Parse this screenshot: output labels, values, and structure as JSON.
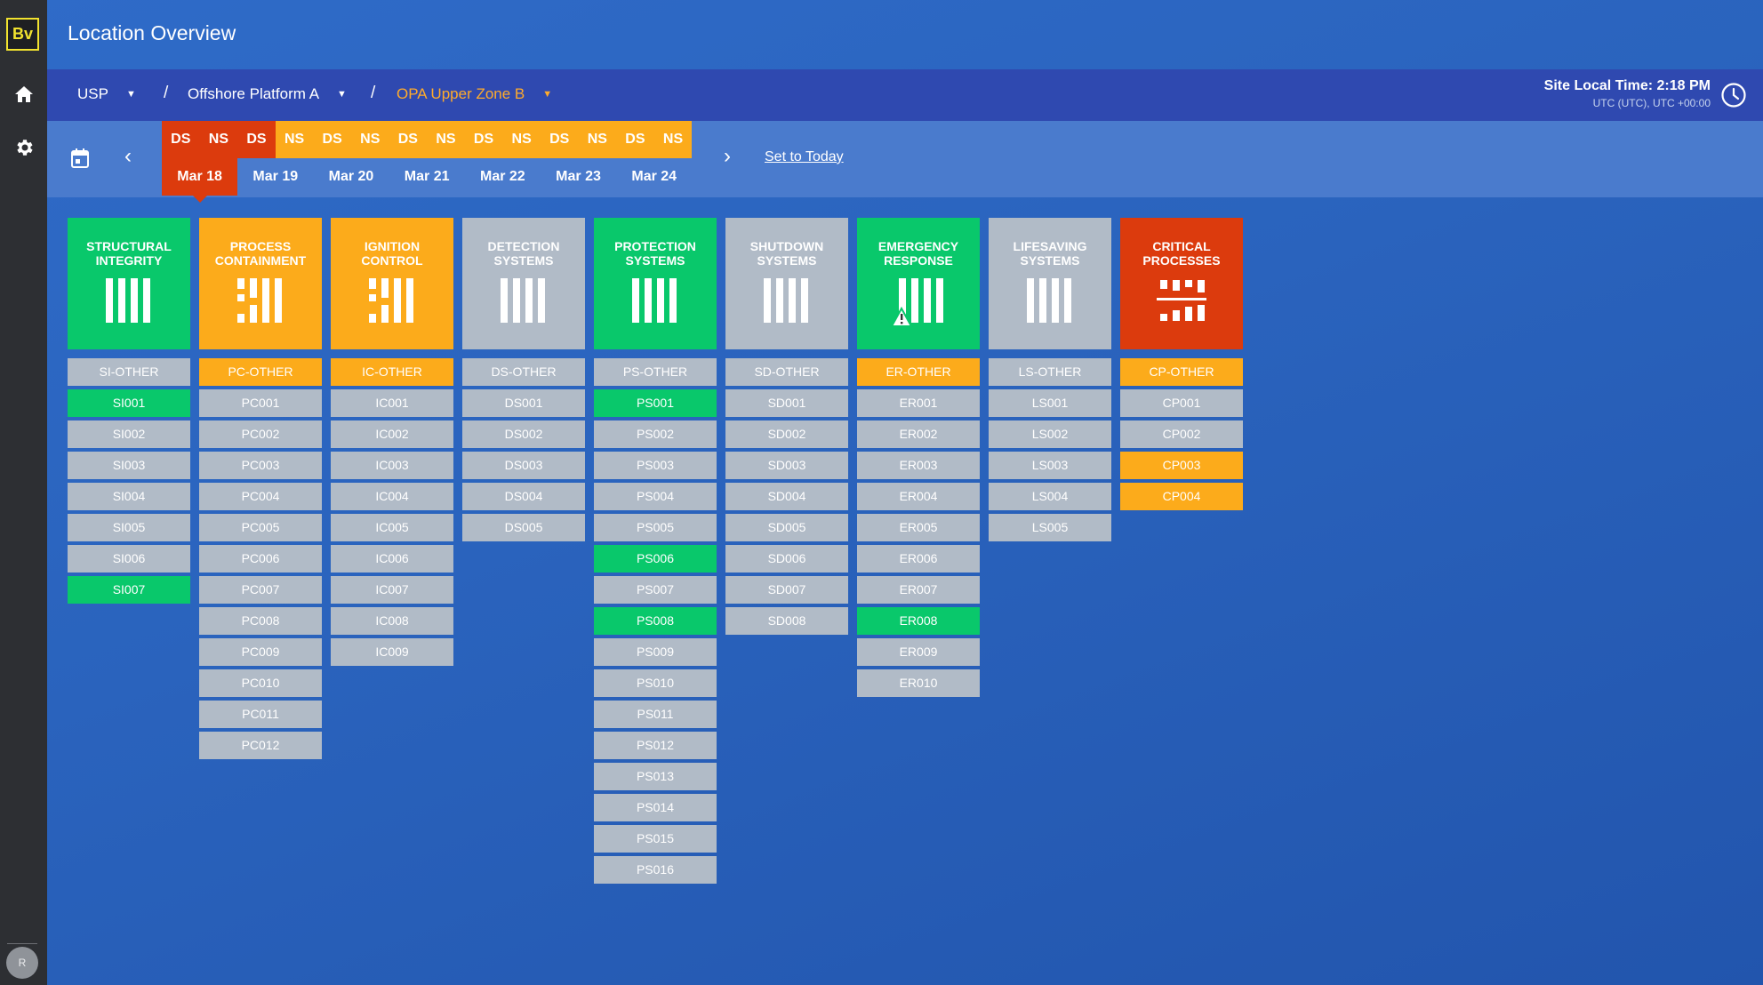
{
  "app": {
    "logo": "Bv",
    "title": "Location Overview"
  },
  "rail": {
    "home_icon": "home-icon",
    "settings_icon": "gear-icon",
    "avatar_initial": "R"
  },
  "breadcrumb": {
    "items": [
      {
        "label": "USP"
      },
      {
        "label": "Offshore Platform A"
      },
      {
        "label": "OPA Upper Zone B"
      }
    ],
    "separator": "/"
  },
  "site_time": {
    "label": "Site Local Time: 2:18 PM",
    "timezone": "UTC (UTC), UTC +00:00"
  },
  "date_nav": {
    "shifts": [
      "DS",
      "NS",
      "DS",
      "NS",
      "DS",
      "NS",
      "DS",
      "NS",
      "DS",
      "NS",
      "DS",
      "NS",
      "DS",
      "NS"
    ],
    "days": [
      "Mar 18",
      "Mar 19",
      "Mar 20",
      "Mar 21",
      "Mar 22",
      "Mar 23",
      "Mar 24"
    ],
    "set_today": "Set to Today",
    "prev": "‹",
    "next": "›"
  },
  "colors": {
    "green": "#09c86b",
    "amber": "#fcab1b",
    "red": "#dc3b0d",
    "grey": "#b1bbc7",
    "header": "#2f49b0"
  },
  "columns": [
    {
      "title": [
        "STRUCTURAL",
        "INTEGRITY"
      ],
      "status": "green",
      "glyph": "bars",
      "items": [
        [
          "SI-OTHER",
          "grey"
        ],
        [
          "SI001",
          "green"
        ],
        [
          "SI002",
          "grey"
        ],
        [
          "SI003",
          "grey"
        ],
        [
          "SI004",
          "grey"
        ],
        [
          "SI005",
          "grey"
        ],
        [
          "SI006",
          "grey"
        ],
        [
          "SI007",
          "green"
        ]
      ]
    },
    {
      "title": [
        "PROCESS",
        "CONTAINMENT"
      ],
      "status": "amber",
      "glyph": "broken",
      "items": [
        [
          "PC-OTHER",
          "amber"
        ],
        [
          "PC001",
          "grey"
        ],
        [
          "PC002",
          "grey"
        ],
        [
          "PC003",
          "grey"
        ],
        [
          "PC004",
          "grey"
        ],
        [
          "PC005",
          "grey"
        ],
        [
          "PC006",
          "grey"
        ],
        [
          "PC007",
          "grey"
        ],
        [
          "PC008",
          "grey"
        ],
        [
          "PC009",
          "grey"
        ],
        [
          "PC010",
          "grey"
        ],
        [
          "PC011",
          "grey"
        ],
        [
          "PC012",
          "grey"
        ]
      ]
    },
    {
      "title": [
        "IGNITION",
        "CONTROL"
      ],
      "status": "amber",
      "glyph": "broken",
      "items": [
        [
          "IC-OTHER",
          "amber"
        ],
        [
          "IC001",
          "grey"
        ],
        [
          "IC002",
          "grey"
        ],
        [
          "IC003",
          "grey"
        ],
        [
          "IC004",
          "grey"
        ],
        [
          "IC005",
          "grey"
        ],
        [
          "IC006",
          "grey"
        ],
        [
          "IC007",
          "grey"
        ],
        [
          "IC008",
          "grey"
        ],
        [
          "IC009",
          "grey"
        ]
      ]
    },
    {
      "title": [
        "DETECTION",
        "SYSTEMS"
      ],
      "status": "grey",
      "glyph": "bars",
      "items": [
        [
          "DS-OTHER",
          "grey"
        ],
        [
          "DS001",
          "grey"
        ],
        [
          "DS002",
          "grey"
        ],
        [
          "DS003",
          "grey"
        ],
        [
          "DS004",
          "grey"
        ],
        [
          "DS005",
          "grey"
        ]
      ]
    },
    {
      "title": [
        "PROTECTION",
        "SYSTEMS"
      ],
      "status": "green",
      "glyph": "bars",
      "items": [
        [
          "PS-OTHER",
          "grey"
        ],
        [
          "PS001",
          "green"
        ],
        [
          "PS002",
          "grey"
        ],
        [
          "PS003",
          "grey"
        ],
        [
          "PS004",
          "grey"
        ],
        [
          "PS005",
          "grey"
        ],
        [
          "PS006",
          "green"
        ],
        [
          "PS007",
          "grey"
        ],
        [
          "PS008",
          "green"
        ],
        [
          "PS009",
          "grey"
        ],
        [
          "PS010",
          "grey"
        ],
        [
          "PS011",
          "grey"
        ],
        [
          "PS012",
          "grey"
        ],
        [
          "PS013",
          "grey"
        ],
        [
          "PS014",
          "grey"
        ],
        [
          "PS015",
          "grey"
        ],
        [
          "PS016",
          "grey"
        ]
      ]
    },
    {
      "title": [
        "SHUTDOWN",
        "SYSTEMS"
      ],
      "status": "grey",
      "glyph": "bars",
      "items": [
        [
          "SD-OTHER",
          "grey"
        ],
        [
          "SD001",
          "grey"
        ],
        [
          "SD002",
          "grey"
        ],
        [
          "SD003",
          "grey"
        ],
        [
          "SD004",
          "grey"
        ],
        [
          "SD005",
          "grey"
        ],
        [
          "SD006",
          "grey"
        ],
        [
          "SD007",
          "grey"
        ],
        [
          "SD008",
          "grey"
        ]
      ]
    },
    {
      "title": [
        "EMERGENCY",
        "RESPONSE"
      ],
      "status": "green",
      "glyph": "warning",
      "items": [
        [
          "ER-OTHER",
          "amber"
        ],
        [
          "ER001",
          "grey"
        ],
        [
          "ER002",
          "grey"
        ],
        [
          "ER003",
          "grey"
        ],
        [
          "ER004",
          "grey"
        ],
        [
          "ER005",
          "grey"
        ],
        [
          "ER006",
          "grey"
        ],
        [
          "ER007",
          "grey"
        ],
        [
          "ER008",
          "green"
        ],
        [
          "ER009",
          "grey"
        ],
        [
          "ER010",
          "grey"
        ]
      ]
    },
    {
      "title": [
        "LIFESAVING",
        "SYSTEMS"
      ],
      "status": "grey",
      "glyph": "bars",
      "items": [
        [
          "LS-OTHER",
          "grey"
        ],
        [
          "LS001",
          "grey"
        ],
        [
          "LS002",
          "grey"
        ],
        [
          "LS003",
          "grey"
        ],
        [
          "LS004",
          "grey"
        ],
        [
          "LS005",
          "grey"
        ]
      ]
    },
    {
      "title": [
        "CRITICAL",
        "PROCESSES"
      ],
      "status": "red",
      "glyph": "critical",
      "items": [
        [
          "CP-OTHER",
          "amber"
        ],
        [
          "CP001",
          "grey"
        ],
        [
          "CP002",
          "grey"
        ],
        [
          "CP003",
          "amber"
        ],
        [
          "CP004",
          "amber"
        ]
      ]
    }
  ]
}
